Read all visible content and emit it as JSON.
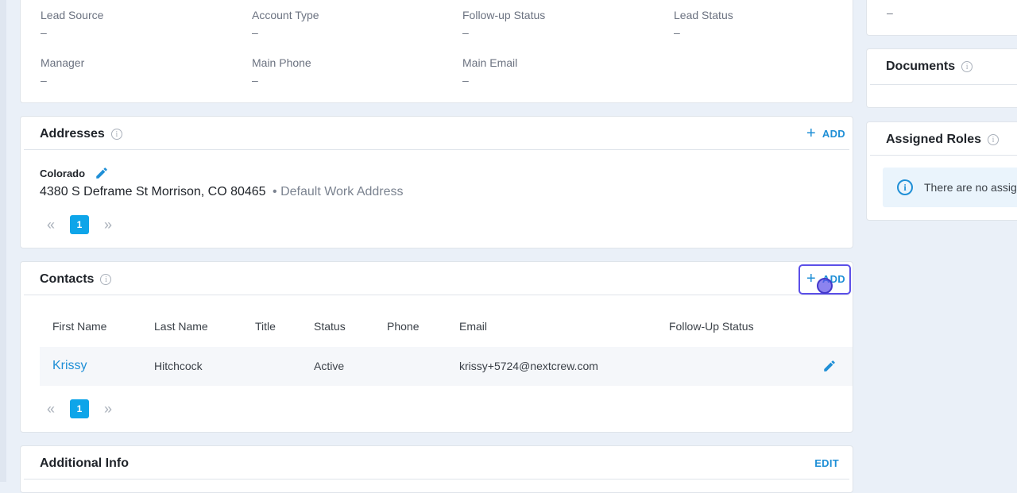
{
  "details": {
    "fields": [
      {
        "label": "Lead Source",
        "value": "–"
      },
      {
        "label": "Account Type",
        "value": "–"
      },
      {
        "label": "Follow-up Status",
        "value": "–"
      },
      {
        "label": "Lead Status",
        "value": "–"
      },
      {
        "label": "Manager",
        "value": "–"
      },
      {
        "label": "Main Phone",
        "value": "–"
      },
      {
        "label": "Main Email",
        "value": "–"
      }
    ]
  },
  "addresses": {
    "title": "Addresses",
    "add_label": "ADD",
    "name": "Colorado",
    "address_line": "4380 S Deframe St Morrison, CO 80465",
    "tag": "• Default Work Address",
    "current_page": "1"
  },
  "contacts": {
    "title": "Contacts",
    "add_label": "ADD",
    "columns": [
      "First Name",
      "Last Name",
      "Title",
      "Status",
      "Phone",
      "Email",
      "Follow-Up Status"
    ],
    "rows": [
      {
        "first": "Krissy",
        "last": "Hitchcock",
        "title": "",
        "status": "Active",
        "phone": "",
        "email": "krissy+5724@nextcrew.com",
        "follow_up": ""
      }
    ],
    "current_page": "1"
  },
  "additional_info": {
    "title": "Additional Info",
    "edit_label": "EDIT"
  },
  "sidebar": {
    "top_value": "–",
    "documents_title": "Documents",
    "roles_title": "Assigned Roles",
    "roles_empty": "There are no assig"
  },
  "colors": {
    "accent": "#1f8fd6",
    "page_badge": "#0ea5e9",
    "highlight": "#5b4fe8"
  }
}
